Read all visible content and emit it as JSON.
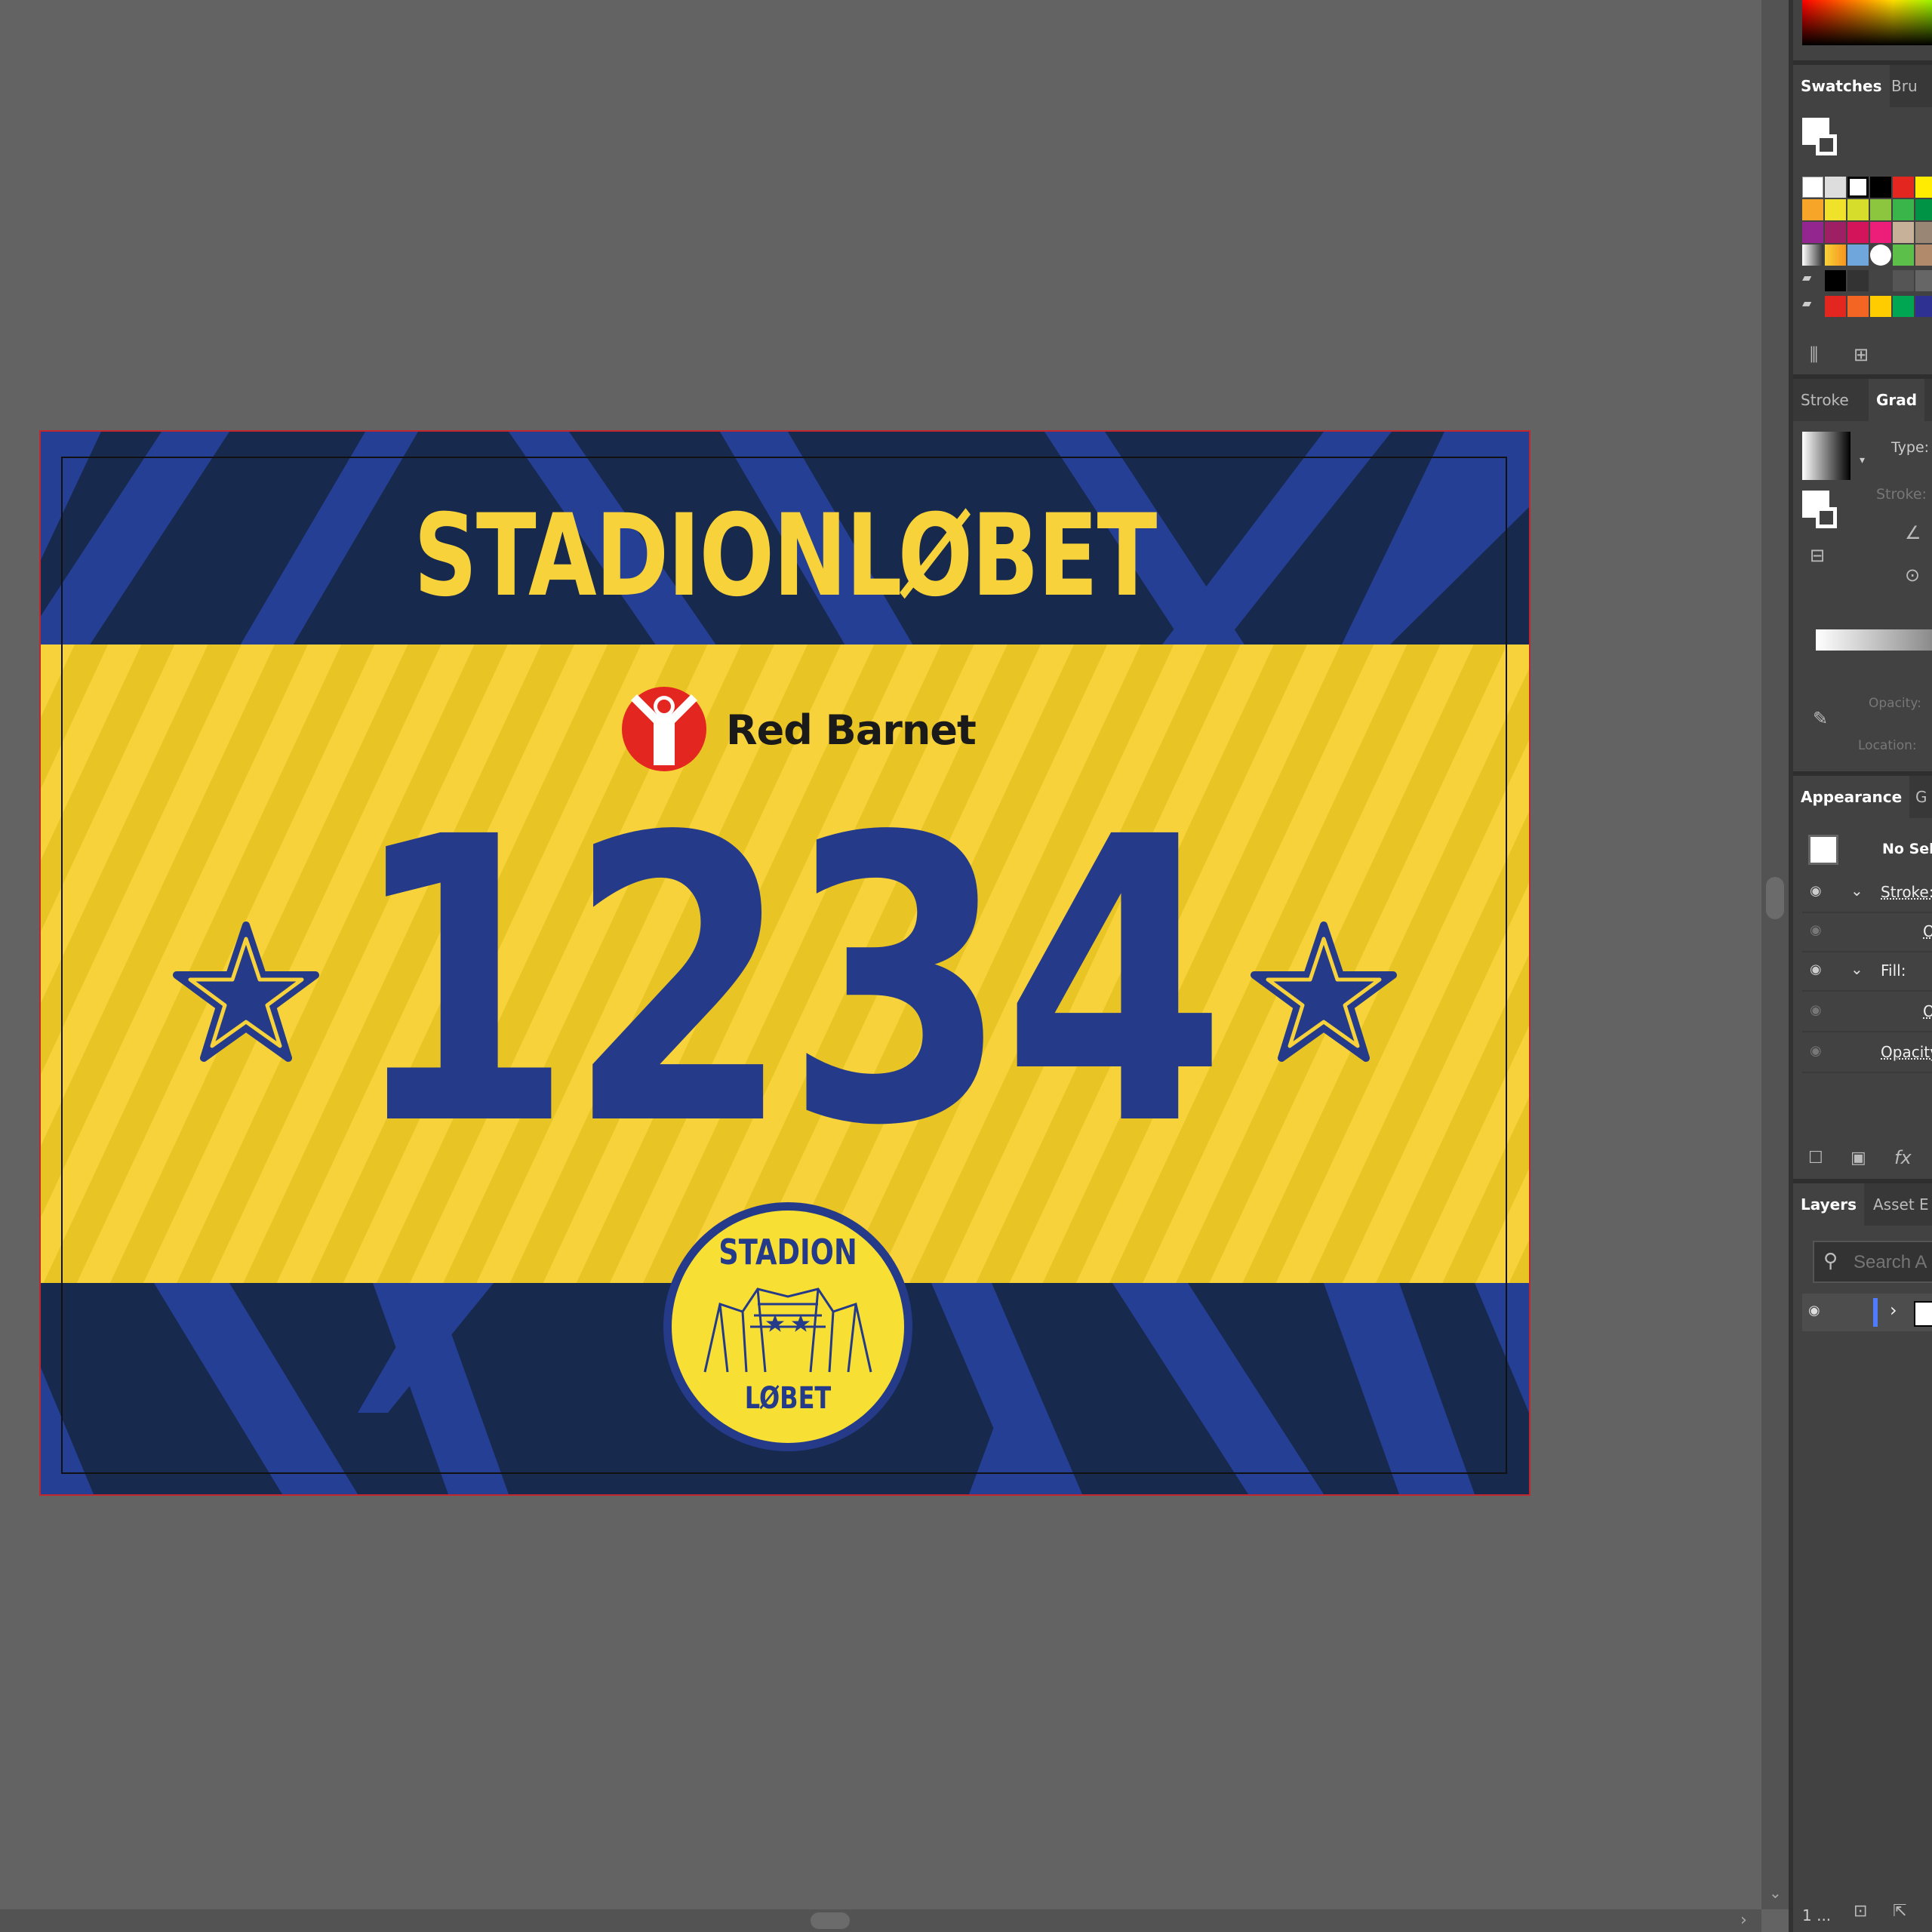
{
  "artboard": {
    "event_title": "STADIONLØBET",
    "sponsor_name": "Red Barnet",
    "bib_number": "1234",
    "badge_top": "STADION",
    "badge_bottom": "LØBET",
    "colors": {
      "navy": "#17294d",
      "blue": "#253f94",
      "yellow": "#f7d23a",
      "yellow_dark": "#e8c424",
      "sponsor_red": "#e3261f"
    }
  },
  "panels": {
    "swatches_tabs": [
      "Swatches",
      "Bru"
    ],
    "gradient_tabs": [
      "Stroke",
      "Grad"
    ],
    "gradient": {
      "type_label": "Type:",
      "stroke_label": "Stroke:",
      "opacity_label": "Opacity:",
      "location_label": "Location:"
    },
    "appearance_tabs": [
      "Appearance",
      "G"
    ],
    "appearance": {
      "selection": "No Sel",
      "rows": [
        {
          "label": "Stroke:"
        },
        {
          "label": "O"
        },
        {
          "label": "Fill:"
        },
        {
          "label": "O"
        },
        {
          "label": "Opacity"
        }
      ]
    },
    "layers_tabs": [
      "Layers",
      "Asset E"
    ],
    "layers": {
      "search_placeholder": "Search A"
    },
    "status": {
      "layer_count": "1 ..."
    }
  }
}
